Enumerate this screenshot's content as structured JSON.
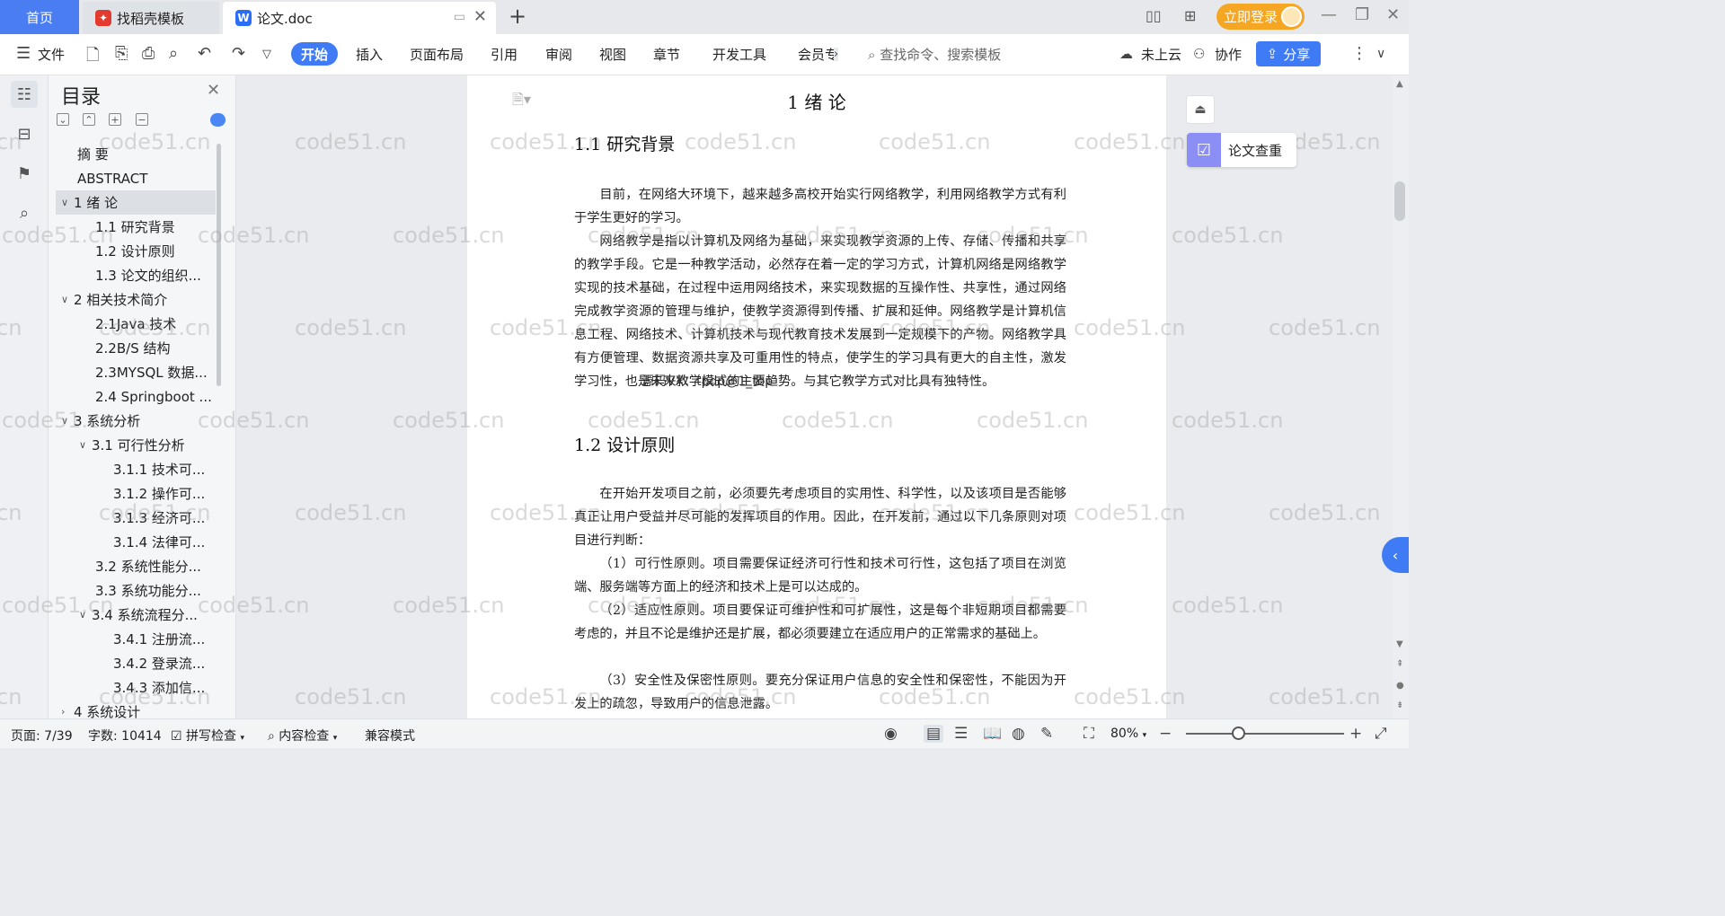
{
  "tabbar": {
    "home": "首页",
    "templates_tab": "找稻壳模板",
    "doc_tab": "论文.doc",
    "login": "立即登录"
  },
  "toolbar": {
    "file": "文件",
    "start": "开始",
    "insert": "插入",
    "page_layout": "页面布局",
    "references": "引用",
    "review": "审阅",
    "view": "视图",
    "chapter": "章节",
    "dev_tools": "开发工具",
    "member": "会员专",
    "search_placeholder": "查找命令、搜索模板",
    "cloud": "未上云",
    "collab": "协作",
    "share": "分享"
  },
  "toc": {
    "title": "目录",
    "items": [
      {
        "label": "摘 要",
        "level": 1,
        "caret": ""
      },
      {
        "label": "ABSTRACT",
        "level": 1,
        "caret": ""
      },
      {
        "label": "1 绪 论",
        "level": 1,
        "caret": "v",
        "selected": true
      },
      {
        "label": "1.1 研究背景",
        "level": 2,
        "caret": ""
      },
      {
        "label": "1.2 设计原则",
        "level": 2,
        "caret": ""
      },
      {
        "label": "1.3 论文的组织...",
        "level": 2,
        "caret": ""
      },
      {
        "label": "2 相关技术简介",
        "level": 1,
        "caret": "v"
      },
      {
        "label": "2.1Java 技术",
        "level": 2,
        "caret": ""
      },
      {
        "label": "2.2B/S 结构",
        "level": 2,
        "caret": ""
      },
      {
        "label": "2.3MYSQL 数据...",
        "level": 2,
        "caret": ""
      },
      {
        "label": "2.4 Springboot ...",
        "level": 2,
        "caret": ""
      },
      {
        "label": "3 系统分析",
        "level": 1,
        "caret": "v"
      },
      {
        "label": "3.1 可行性分析",
        "level": 2,
        "caret": "v"
      },
      {
        "label": "3.1.1 技术可...",
        "level": 3,
        "caret": ""
      },
      {
        "label": "3.1.2 操作可...",
        "level": 3,
        "caret": ""
      },
      {
        "label": "3.1.3 经济可...",
        "level": 3,
        "caret": ""
      },
      {
        "label": "3.1.4 法律可...",
        "level": 3,
        "caret": ""
      },
      {
        "label": "3.2 系统性能分...",
        "level": 2,
        "caret": ""
      },
      {
        "label": "3.3 系统功能分...",
        "level": 2,
        "caret": ""
      },
      {
        "label": "3.4 系统流程分...",
        "level": 2,
        "caret": "v"
      },
      {
        "label": "3.4.1 注册流...",
        "level": 3,
        "caret": ""
      },
      {
        "label": "3.4.2 登录流...",
        "level": 3,
        "caret": ""
      },
      {
        "label": "3.4.3 添加信...",
        "level": 3,
        "caret": ""
      },
      {
        "label": "4 系统设计",
        "level": 1,
        "caret": ">"
      }
    ]
  },
  "document": {
    "h1": "1 绪 论",
    "h2_1": "1.1 研究背景",
    "p1": "目前，在网络大环境下，越来越多高校开始实行网络教学，利用网络教学方式有利于学生更好的学习。",
    "p2": "网络教学是指以计算机及网络为基础，来实现教学资源的上传、存储、传播和共享的教学手段。它是一种教学活动，必然存在着一定的学习方式，计算机网络是网络教学实现的技术基础，在过程中运用网络技术，来实现数据的互操作性、共享性，通过网络完成教学资源的管理与维护，使教学资源得到传播、扩展和延伸。网络教学是计算机信息工程、网络技术、计算机技术与现代教育技术发展到一定规模下的产物。网络教学具有方便管理、数据资源共享及可重用性的特点，使学生的学习具有更大的自主性，激发学习性，也是未来教学模式的主要趋势。与其它教学方式对比具有独特性。",
    "overlay": "源码VX：tpdp@1_top",
    "h2_2": "1.2 设计原则",
    "p3": "在开始开发项目之前，必须要先考虑项目的实用性、科学性，以及该项目是否能够真正让用户受益并尽可能的发挥项目的作用。因此，在开发前，通过以下几条原则对项目进行判断：",
    "p4": "（1）可行性原则。项目需要保证经济可行性和技术可行性，这包括了项目在浏览端、服务端等方面上的经济和技术上是可以达成的。",
    "p5": "（2）适应性原则。项目要保证可维护性和可扩展性，这是每个非短期项目都需要考虑的，并且不论是维护还是扩展，都必须要建立在适应用户的正常需求的基础上。",
    "p6": "（3）安全性及保密性原则。要充分保证用户信息的安全性和保密性，不能因为开发上的疏忽，导致用户的信息泄露。"
  },
  "watermark": "code51.cn",
  "right_panel": {
    "paper_check": "论文查重"
  },
  "status": {
    "page": "页面: 7/39",
    "words": "字数: 10414",
    "spell": "拼写检查",
    "content_check": "内容检查",
    "compat": "兼容模式",
    "zoom": "80%",
    "zoom_level": 0.33
  },
  "colors": {
    "accent": "#3e7bf5",
    "login": "#f5a623",
    "home_tab": "#4a7cf2"
  }
}
